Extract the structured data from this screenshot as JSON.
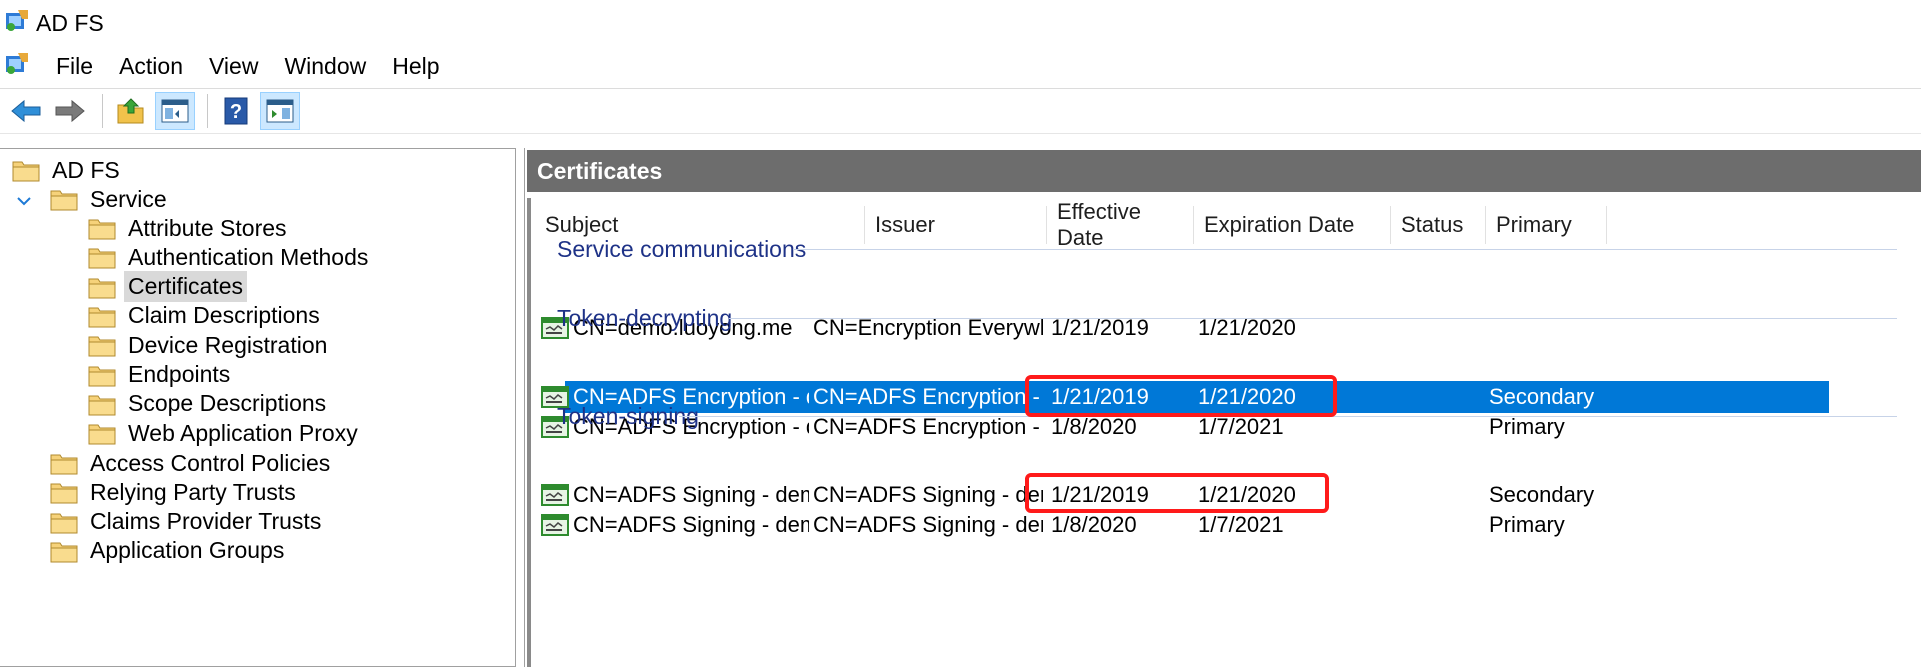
{
  "window": {
    "title": "AD FS",
    "icon": "adfs-app-icon"
  },
  "menu": [
    "File",
    "Action",
    "View",
    "Window",
    "Help"
  ],
  "toolbar": {
    "buttons": [
      "back-arrow-icon",
      "forward-arrow-icon",
      "up-folder-icon",
      "show-hide-console-tree-icon",
      "help-icon",
      "show-hide-action-pane-icon"
    ]
  },
  "tree": {
    "root": "AD FS",
    "service": "Service",
    "service_children": [
      "Attribute Stores",
      "Authentication Methods",
      "Certificates",
      "Claim Descriptions",
      "Device Registration",
      "Endpoints",
      "Scope Descriptions",
      "Web Application Proxy"
    ],
    "others": [
      "Access Control Policies",
      "Relying Party Trusts",
      "Claims Provider Trusts",
      "Application Groups"
    ],
    "selected": "Certificates"
  },
  "content": {
    "title": "Certificates",
    "columns": [
      "Subject",
      "Issuer",
      "Effective Date",
      "Expiration Date",
      "Status",
      "Primary"
    ],
    "groups": [
      {
        "name": "Service communications",
        "rows": [
          {
            "subject": "CN=demo.luoyong.me",
            "issuer": "CN=Encryption Everywher...",
            "effective": "1/21/2019",
            "expiration": "1/21/2020",
            "status": "",
            "primary": "",
            "selected": false
          }
        ]
      },
      {
        "name": "Token-decrypting",
        "rows": [
          {
            "subject": "CN=ADFS Encryption - dem...",
            "issuer": "CN=ADFS Encryption - de...",
            "effective": "1/21/2019",
            "expiration": "1/21/2020",
            "status": "",
            "primary": "Secondary",
            "selected": true
          },
          {
            "subject": "CN=ADFS Encryption - dem...",
            "issuer": "CN=ADFS Encryption - de...",
            "effective": "1/8/2020",
            "expiration": "1/7/2021",
            "status": "",
            "primary": "Primary",
            "selected": false
          }
        ]
      },
      {
        "name": "Token-signing",
        "rows": [
          {
            "subject": "CN=ADFS Signing - demo.l...",
            "issuer": "CN=ADFS Signing - demo...",
            "effective": "1/21/2019",
            "expiration": "1/21/2020",
            "status": "",
            "primary": "Secondary",
            "selected": false
          },
          {
            "subject": "CN=ADFS Signing - demo.l...",
            "issuer": "CN=ADFS Signing - demo...",
            "effective": "1/8/2020",
            "expiration": "1/7/2021",
            "status": "",
            "primary": "Primary",
            "selected": false
          }
        ]
      }
    ]
  },
  "colors": {
    "selection": "#0078d7",
    "header_bg": "#6d6d6d",
    "group_text": "#1e3287",
    "annotation": "#ff1a1a"
  }
}
